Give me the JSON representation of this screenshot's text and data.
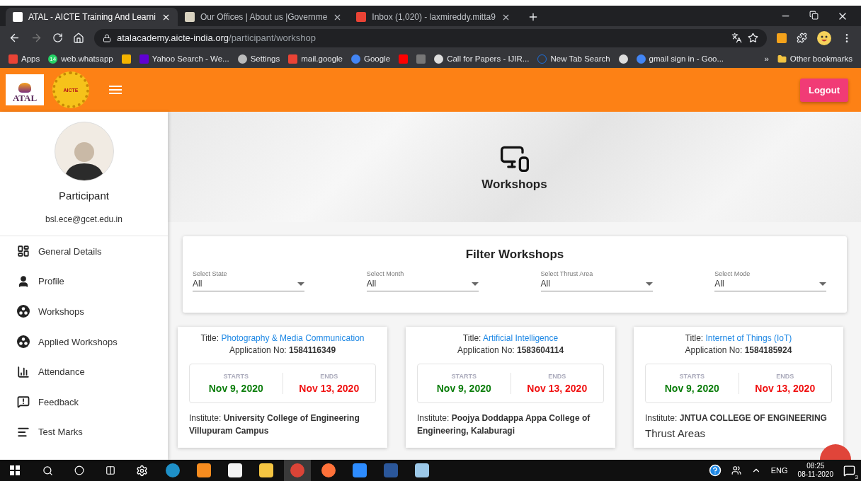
{
  "browser": {
    "tabs": [
      {
        "title": "ATAL - AICTE Training And Learni",
        "selected": true
      },
      {
        "title": "Our Offices | About us |Governme",
        "selected": false
      },
      {
        "title": "Inbox (1,020) - laxmireddy.mitta9",
        "selected": false
      }
    ],
    "url": {
      "host": "atalacademy.aicte-india.org",
      "path": "/participant/workshop"
    },
    "bookmarks": [
      {
        "kind": "link",
        "label": "Apps"
      },
      {
        "kind": "link",
        "badge": "14",
        "label": "web.whatsapp"
      },
      {
        "kind": "icon"
      },
      {
        "kind": "link",
        "label": "Yahoo Search - We..."
      },
      {
        "kind": "link",
        "label": "Settings"
      },
      {
        "kind": "link",
        "label": "mail.google"
      },
      {
        "kind": "link",
        "label": "Google"
      },
      {
        "kind": "icon"
      },
      {
        "kind": "icon"
      },
      {
        "kind": "link",
        "label": "Call for Papers - IJIR..."
      },
      {
        "kind": "link",
        "label": "New Tab Search"
      },
      {
        "kind": "icon"
      },
      {
        "kind": "link",
        "label": "gmail sign in - Goo..."
      }
    ],
    "more": "»",
    "other_bookmarks": "Other bookmarks"
  },
  "header": {
    "logo_text": "ATAL",
    "emblem_text": "AICTE",
    "logout": "Logout"
  },
  "sidebar": {
    "role": "Participant",
    "email": "bsl.ece@gcet.edu.in",
    "menu": [
      {
        "label": "General Details"
      },
      {
        "label": "Profile"
      },
      {
        "label": "Workshops"
      },
      {
        "label": "Applied Workshops"
      },
      {
        "label": "Attendance"
      },
      {
        "label": "Feedback"
      },
      {
        "label": "Test Marks"
      }
    ]
  },
  "hero": {
    "title": "Workshops"
  },
  "filter": {
    "title": "Filter Workshops",
    "selects": [
      {
        "label": "Select State",
        "value": "All"
      },
      {
        "label": "Select Month",
        "value": "All"
      },
      {
        "label": "Select Thrust Area",
        "value": "All"
      },
      {
        "label": "Select Mode",
        "value": "All"
      }
    ]
  },
  "workshops": [
    {
      "title_label": "Title:",
      "title": "Photography & Media Communication",
      "application": "Application No: **1584116349**",
      "starts_label": "STARTS",
      "starts": "Nov 9, 2020",
      "ends_label": "ENDS",
      "ends": "Nov 13, 2020",
      "institute": "Institute: **University College of Engineering Villupuram Campus**"
    },
    {
      "title_label": "Title:",
      "title": "Artificial Intelligence",
      "application": "Application No: **1583604114**",
      "starts_label": "STARTS",
      "starts": "Nov 9, 2020",
      "ends_label": "ENDS",
      "ends": "Nov 13, 2020",
      "institute": "Institute: **Poojya Doddappa Appa College of Engineering, Kalaburagi**"
    },
    {
      "title_label": "Title:",
      "title": "Internet of Things (IoT)",
      "application": "Application No: **1584185924**",
      "starts_label": "STARTS",
      "starts": "Nov 9, 2020",
      "ends_label": "ENDS",
      "ends": "Nov 13, 2020",
      "institute": "Institute: **JNTUA COLLEGE OF ENGINEERING**",
      "thrust_heading": "Thrust Areas"
    }
  ],
  "taskbar": {
    "apps": [
      {
        "selected": false
      },
      {
        "selected": false
      },
      {
        "selected": false
      },
      {
        "selected": false
      },
      {
        "selected": false
      },
      {
        "selected": true
      },
      {
        "selected": false
      },
      {
        "selected": false
      },
      {
        "selected": false
      },
      {
        "selected": false
      }
    ],
    "language": "ENG",
    "time": "08:25",
    "date": "08-11-2020",
    "notifications": "3"
  }
}
